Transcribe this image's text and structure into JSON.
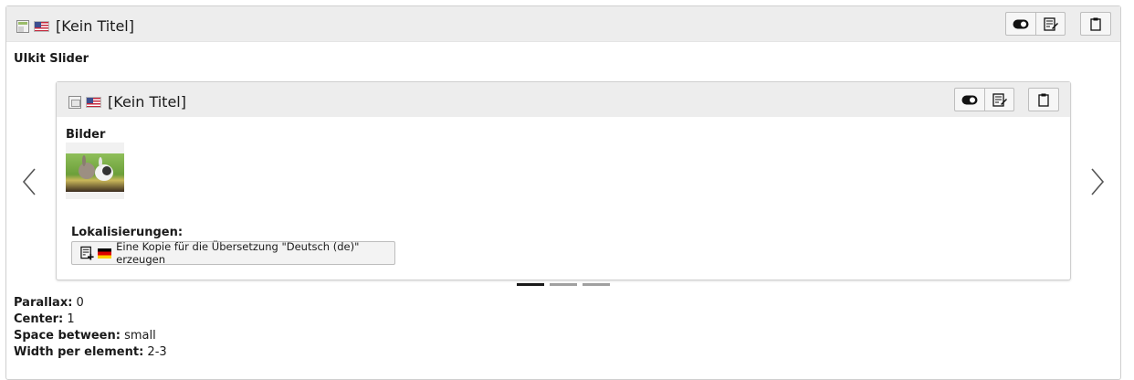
{
  "outer": {
    "title": "[Kein Titel]",
    "type_label": "UIkit Slider",
    "content_type_icon": "content-element-icon",
    "language_flag": "us-flag-icon"
  },
  "inner": {
    "title": "[Kein Titel]",
    "images_label": "Bilder",
    "content_type_icon": "image-content-icon",
    "language_flag": "us-flag-icon",
    "image_icon": "rabbit-thumbnail",
    "localizations_label": "Lokalisierungen:",
    "copy_button_label": "Eine Kopie für die Übersetzung \"Deutsch (de)\" erzeugen"
  },
  "buttons": {
    "toggle_icon": "toggle-icon",
    "edit_icon": "edit-icon",
    "clipboard_icon": "clipboard-icon"
  },
  "slider": {
    "prev_icon": "chevron-left-icon",
    "next_icon": "chevron-right-icon",
    "dot_count": 3,
    "active_dot": 0
  },
  "properties": [
    {
      "label": "Parallax:",
      "value": "0"
    },
    {
      "label": "Center:",
      "value": "1"
    },
    {
      "label": "Space between:",
      "value": "small"
    },
    {
      "label": "Width per element:",
      "value": "2-3"
    }
  ]
}
